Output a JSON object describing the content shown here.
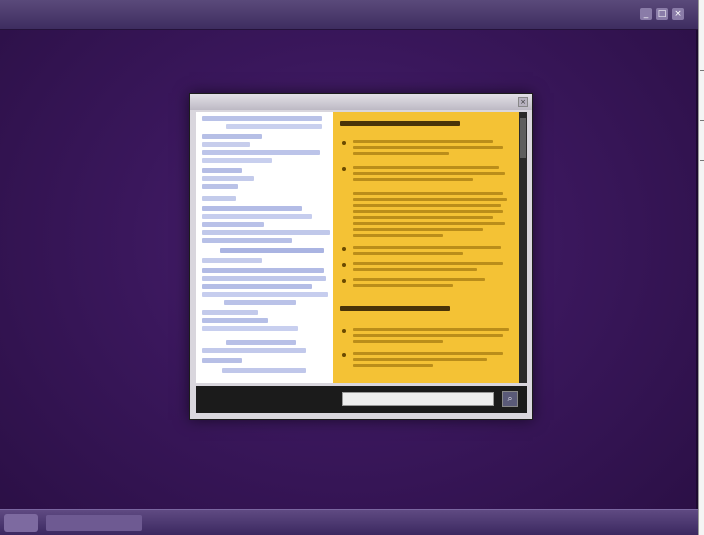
{
  "outer_window": {
    "title": "",
    "controls": [
      "_",
      "□",
      "×"
    ]
  },
  "dialog": {
    "title": "",
    "close_label": "×",
    "right_headings": [
      "",
      ""
    ],
    "bottom_label": "",
    "search_placeholder": "",
    "search_button": "⌕"
  },
  "taskbar": {
    "start_label": "",
    "items": [
      "",
      "",
      "",
      "",
      ""
    ]
  },
  "colors": {
    "desktop": "#3a175c",
    "highlight_panel": "#f4c235",
    "link_text": "#3848a8"
  }
}
